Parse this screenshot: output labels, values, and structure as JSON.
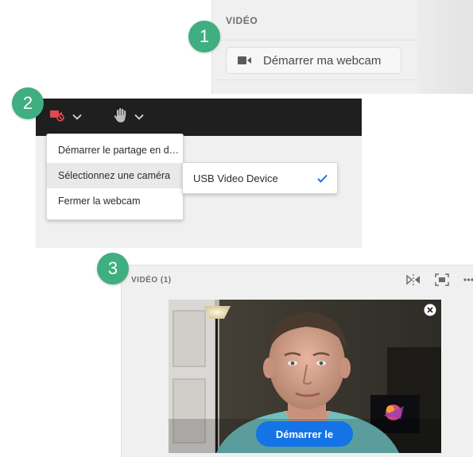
{
  "steps": [
    "1",
    "2",
    "3"
  ],
  "panel1": {
    "section_title": "VIDÉO",
    "start_webcam_button": "Démarrer ma webcam",
    "icon": "camera-icon"
  },
  "panel2": {
    "toolbar": {
      "camera_icon": "camera-off-icon",
      "hand_icon": "raise-hand-icon",
      "dropdown_icon": "chevron-down-icon",
      "camera_color": "#e34850"
    },
    "menu": {
      "items": [
        "Démarrer le partage en d…",
        "Sélectionnez une caméra",
        "Fermer la webcam"
      ],
      "highlighted_index": 1
    },
    "submenu": {
      "device": "USB Video Device",
      "selected": true
    }
  },
  "panel3": {
    "title": "VIDÉO (1)",
    "tools": [
      "mirror-icon",
      "fit-icon",
      "more-icon"
    ],
    "close_icon": "close-icon",
    "start_button": "Démarrer le",
    "accent": "#1473e6"
  },
  "badge_color": "#3fae80"
}
